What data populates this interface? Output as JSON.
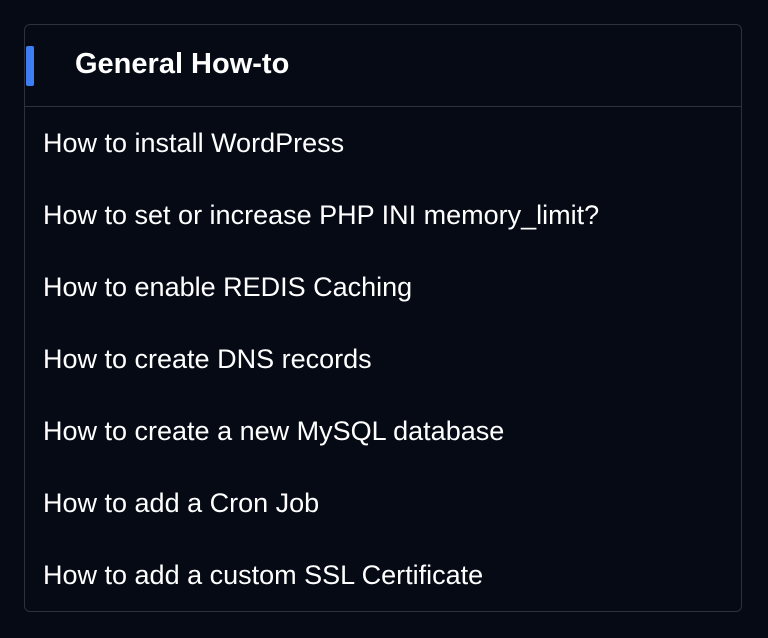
{
  "card": {
    "title": "General How-to",
    "links": [
      "How to install WordPress",
      "How to set or increase PHP INI memory_limit?",
      "How to enable REDIS Caching",
      "How to create DNS records",
      "How to create a new MySQL database",
      "How to add a Cron Job",
      "How to add a custom SSL Certificate"
    ]
  },
  "colors": {
    "background": "#050a15",
    "accent": "#3d7ef5",
    "border": "#2b323d",
    "text": "#ffffff"
  }
}
